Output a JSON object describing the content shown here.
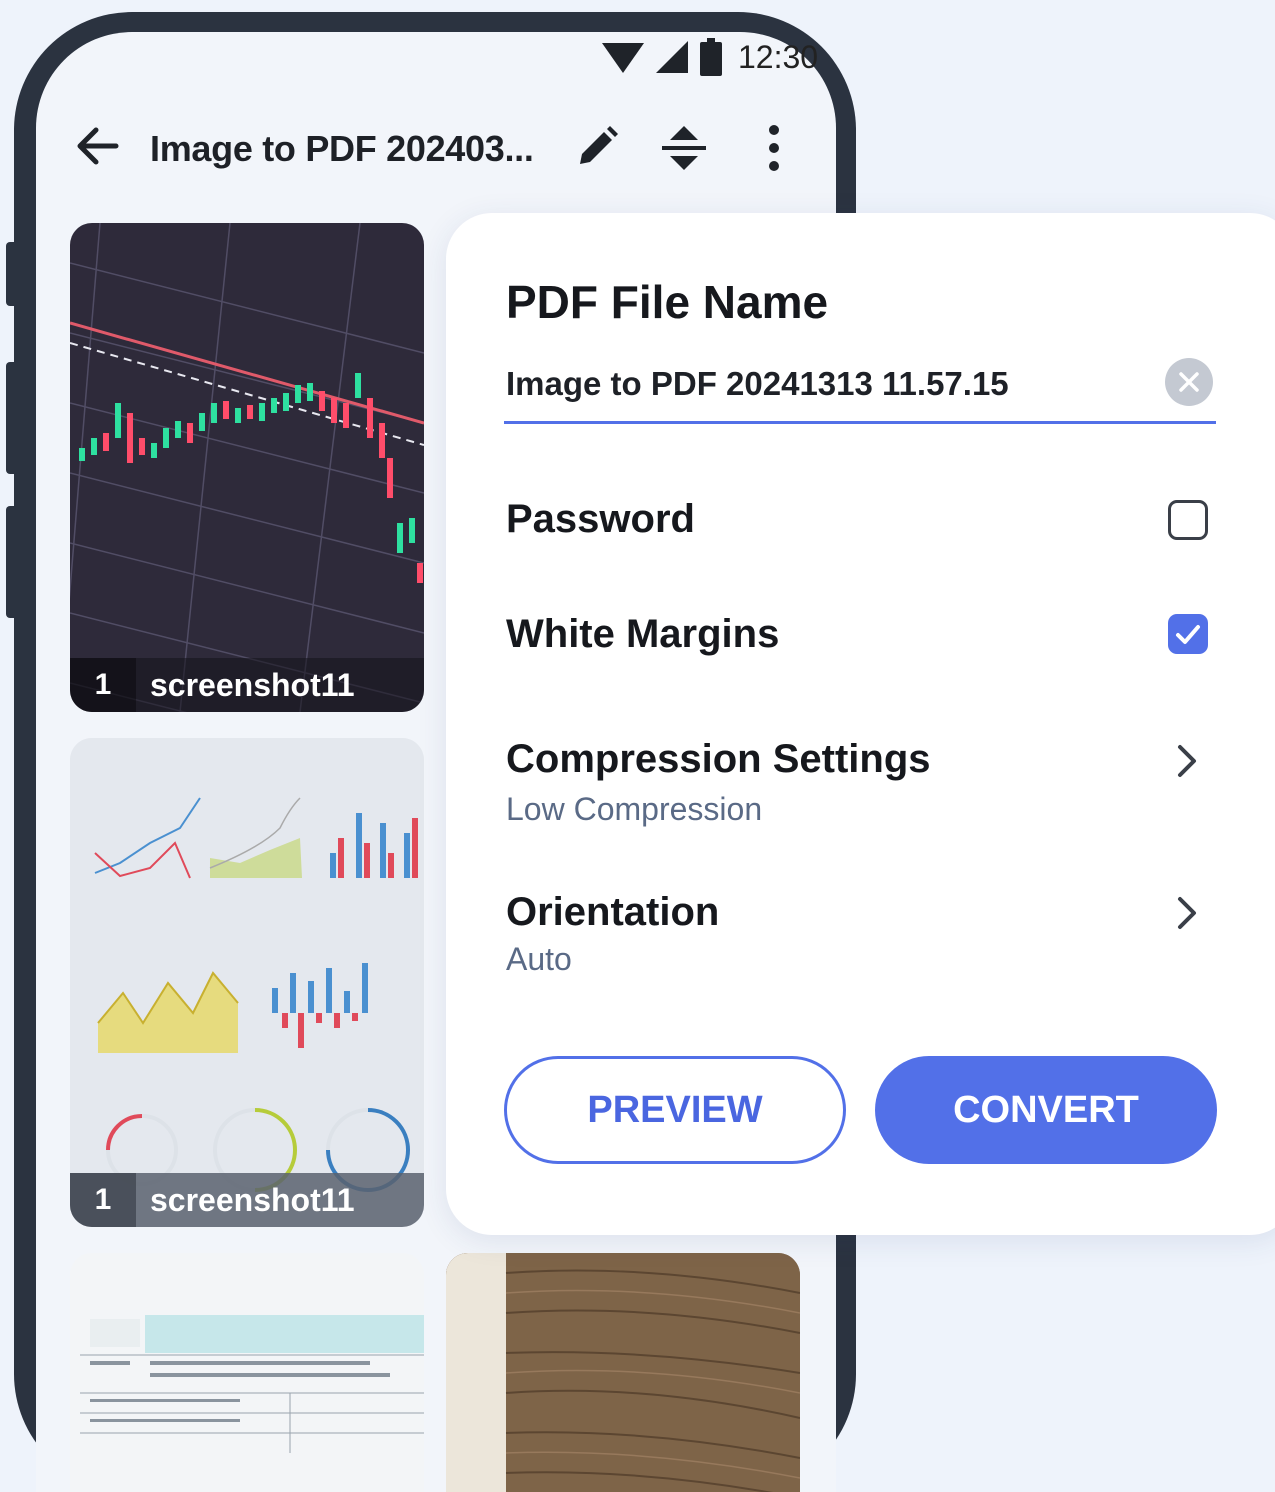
{
  "status_bar": {
    "time": "12:30"
  },
  "toolbar": {
    "title": "Image to PDF 202403...",
    "icons": [
      "back-arrow-icon",
      "pencil-icon",
      "sort-icon",
      "more-vert-icon"
    ]
  },
  "thumbnails": [
    {
      "index": "1",
      "name": "screenshot11"
    },
    {
      "index": "1",
      "name": "screenshot11"
    }
  ],
  "dialog": {
    "title": "PDF File Name",
    "file_name": "Image to PDF 20241313 11.57.15",
    "options": {
      "password": {
        "label": "Password",
        "checked": false
      },
      "white_margins": {
        "label": "White Margins",
        "checked": true
      },
      "compression": {
        "label": "Compression Settings",
        "value": "Low Compression"
      },
      "orientation": {
        "label": "Orientation",
        "value": "Auto"
      }
    },
    "preview_label": "PREVIEW",
    "convert_label": "CONVERT"
  },
  "colors": {
    "accent": "#5270e8",
    "frame": "#2b3340",
    "background": "#eef3fb"
  }
}
